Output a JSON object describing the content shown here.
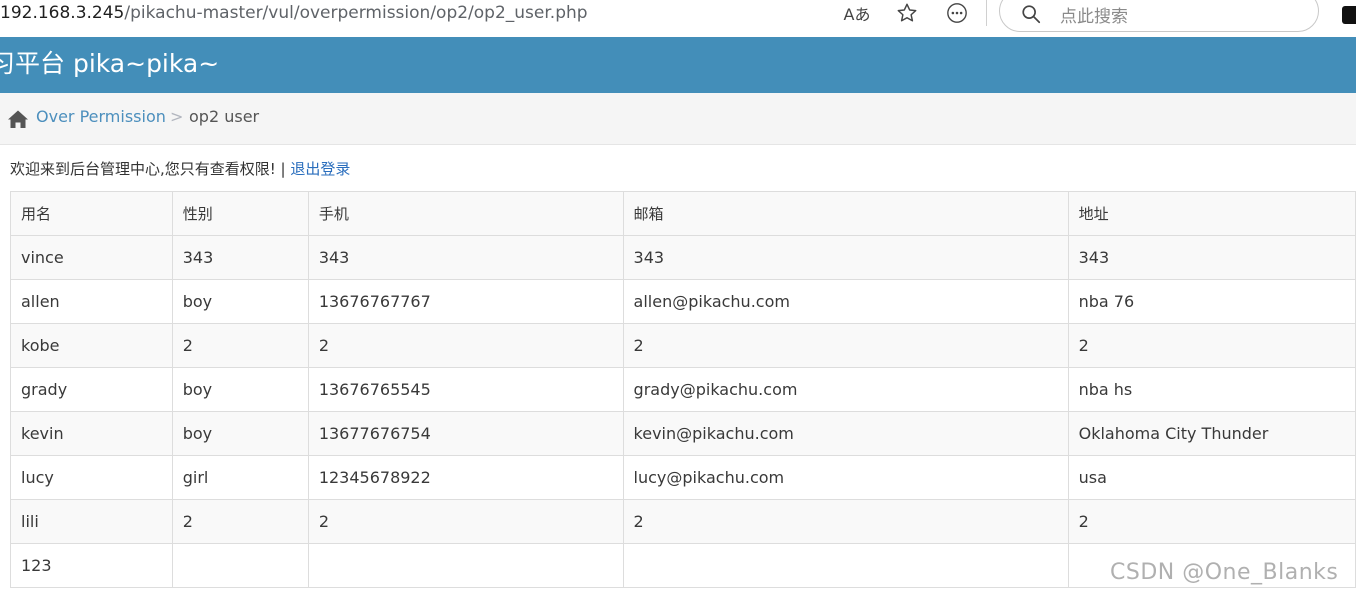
{
  "browser": {
    "url_host": "192.168.3.245",
    "url_path": "/pikachu-master/vul/overpermission/op2/op2_user.php",
    "read_aloud_icon": "Aあ",
    "favorite_icon": "star-icon",
    "more_icon": "more-icon",
    "search_placeholder": "点此搜索"
  },
  "header": {
    "title": "习平台 pika~pika~",
    "background": "#438eb9"
  },
  "breadcrumb": {
    "home_icon": "home-icon",
    "parent": "Over Permission",
    "separator": ">",
    "current": "op2 user"
  },
  "welcome": {
    "text": "欢迎来到后台管理中心,您只有查看权限! | ",
    "logout": "退出登录"
  },
  "table": {
    "headers": [
      "用名",
      "性别",
      "手机",
      "邮箱",
      "地址"
    ],
    "rows": [
      [
        "vince",
        "343",
        "343",
        "343",
        "343"
      ],
      [
        "allen",
        "boy",
        "13676767767",
        "allen@pikachu.com",
        "nba 76"
      ],
      [
        "kobe",
        "2",
        "2",
        "2",
        "2"
      ],
      [
        "grady",
        "boy",
        "13676765545",
        "grady@pikachu.com",
        "nba hs"
      ],
      [
        "kevin",
        "boy",
        "13677676754",
        "kevin@pikachu.com",
        "Oklahoma City Thunder"
      ],
      [
        "lucy",
        "girl",
        "12345678922",
        "lucy@pikachu.com",
        "usa"
      ],
      [
        "lili",
        "2",
        "2",
        "2",
        "2"
      ],
      [
        "123",
        "",
        "",
        "",
        ""
      ]
    ]
  },
  "watermark": "CSDN @One_Blanks"
}
